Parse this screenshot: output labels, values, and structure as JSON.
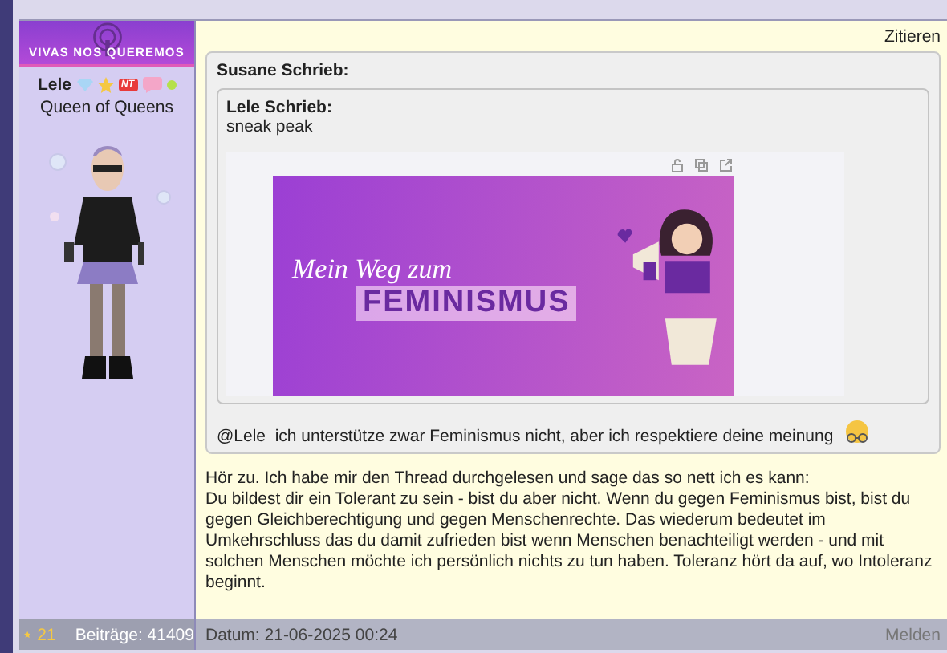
{
  "sidebar": {
    "logo": "VIVAS NOS QUEREMOS",
    "username": "Lele",
    "badge_text": "NT",
    "rank": "Queen of Queens"
  },
  "post": {
    "quote_action": "Zitieren",
    "quote": {
      "author_line": "Susane Schrieb:",
      "nested": {
        "author_line": "Lele Schrieb:",
        "text": "sneak peak",
        "banner": {
          "script_text": "Mein Weg zum",
          "title": "FEMINISMUS"
        }
      },
      "reply": "@Lele  ich unterstütze zwar Feminismus nicht, aber ich respektiere deine meinung"
    },
    "body": [
      "Hör zu. Ich habe mir den Thread durchgelesen und sage das so nett ich es kann:",
      "Du bildest dir ein Tolerant zu sein - bist du aber nicht. Wenn du gegen Feminismus bist, bist du gegen Gleichberechtigung und gegen Menschenrechte. Das wiederum bedeutet im Umkehrschluss das du damit zufrieden bist wenn Menschen benachteiligt werden - und mit solchen Menschen möchte ich persönlich nichts zu tun haben. Toleranz hört da auf, wo Intoleranz beginnt."
    ]
  },
  "footer": {
    "star_count": "21",
    "posts": "Beiträge: 41409",
    "date": "Datum: 21-06-2025 00:24",
    "report": "Melden"
  }
}
